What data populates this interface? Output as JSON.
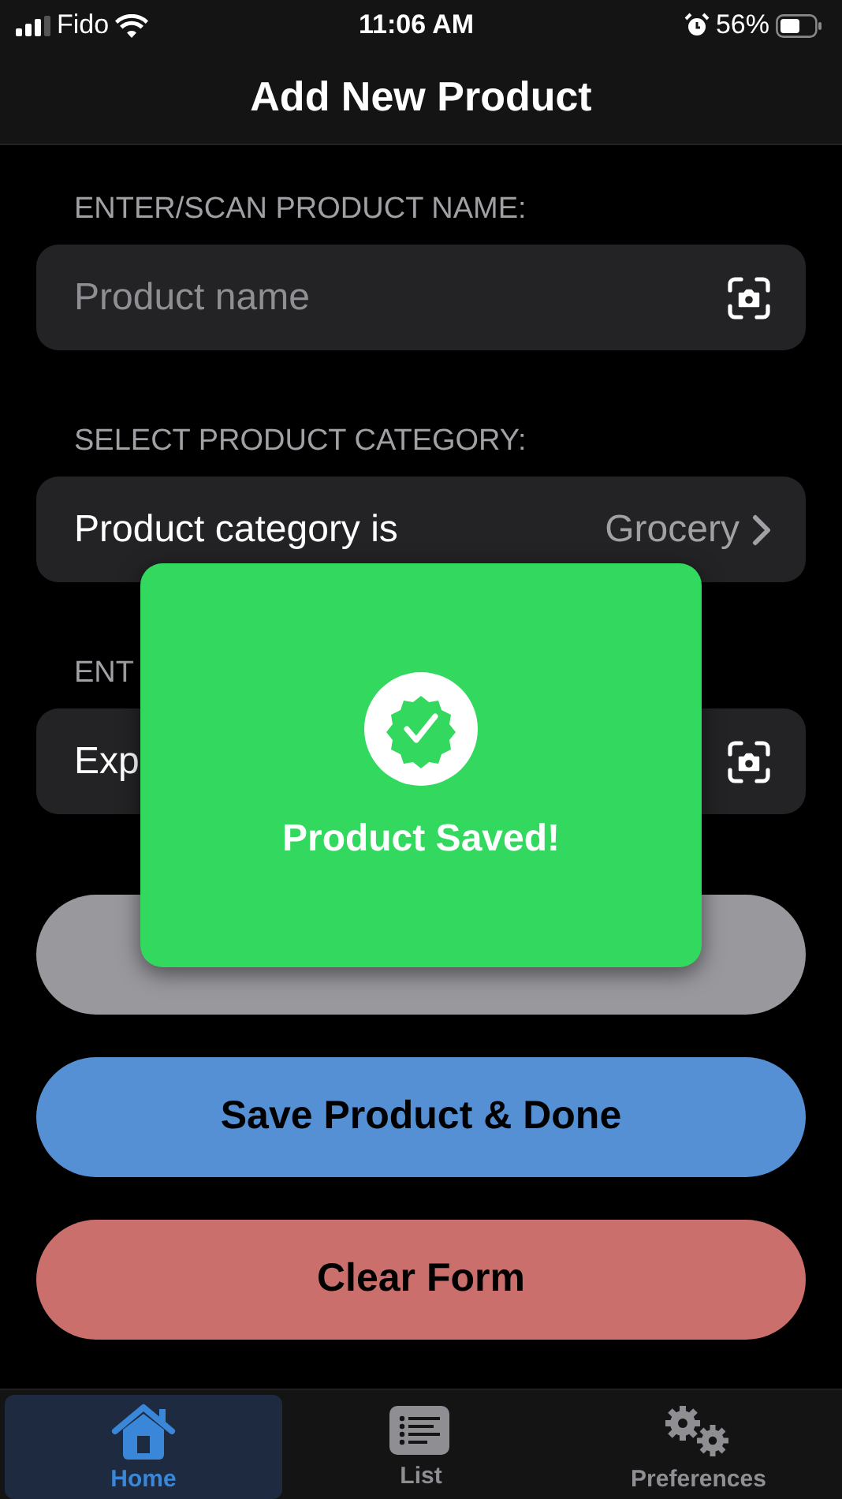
{
  "status_bar": {
    "carrier": "Fido",
    "time": "11:06 AM",
    "battery": "56%"
  },
  "header": {
    "title": "Add New Product"
  },
  "fields": [
    {
      "label": "ENTER/SCAN PRODUCT NAME:",
      "kind": "scan",
      "placeholder": "Product name"
    },
    {
      "label": "SELECT PRODUCT CATEGORY:",
      "kind": "select",
      "text": "Product category is",
      "value": "Grocery"
    },
    {
      "label": "ENT",
      "kind": "scan",
      "value": "Exp"
    }
  ],
  "buttons": [
    {
      "color": "#98989d"
    },
    {
      "label": "Save Product & Done",
      "color": "#5690d4"
    },
    {
      "label": "Clear Form",
      "color": "#cb6f6c"
    }
  ],
  "toast": {
    "message": "Product Saved!"
  },
  "tabs": [
    {
      "label": "Home",
      "kind": "home",
      "selected": true
    },
    {
      "label": "List",
      "kind": "list",
      "selected": false
    },
    {
      "label": "Preferences",
      "kind": "gears",
      "selected": false
    }
  ]
}
